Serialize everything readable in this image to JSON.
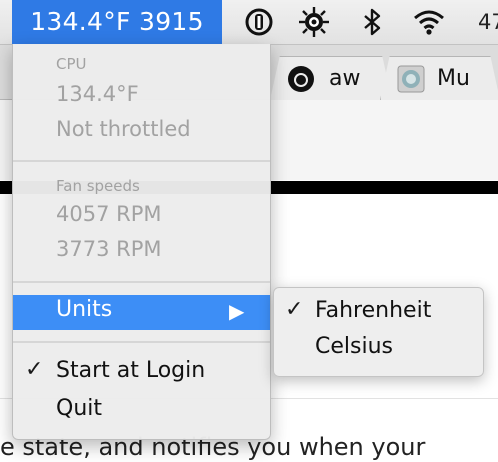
{
  "menubar": {
    "status_text": "134.4°F 3915",
    "icons": [
      "info-circle-icon",
      "gear-sun-icon",
      "bluetooth-icon",
      "wifi-icon"
    ],
    "battery_percent_partial": "47"
  },
  "browser": {
    "tabs": [
      {
        "favicon": "github-icon",
        "label": "aw"
      },
      {
        "favicon": "globe-favicon-icon",
        "label": "Mu"
      }
    ],
    "page_text_partial": "e state, and notifies you when your"
  },
  "menu": {
    "cpu": {
      "heading": "CPU",
      "temperature": "134.4°F",
      "throttle_status": "Not throttled"
    },
    "fans": {
      "heading": "Fan speeds",
      "fan1": "4057 RPM",
      "fan2": "3773 RPM"
    },
    "units_label": "Units",
    "units_arrow": "▶",
    "start_at_login": {
      "label": "Start at Login",
      "checked": true,
      "check_glyph": "✓"
    },
    "quit_label": "Quit"
  },
  "units_submenu": {
    "items": [
      {
        "label": "Fahrenheit",
        "checked": true
      },
      {
        "label": "Celsius",
        "checked": false
      }
    ],
    "check_glyph": "✓"
  },
  "colors": {
    "highlight": "#3d8ef6",
    "status_item_bg": "#2f7ae5",
    "disabled_text": "#a2a2a2"
  }
}
